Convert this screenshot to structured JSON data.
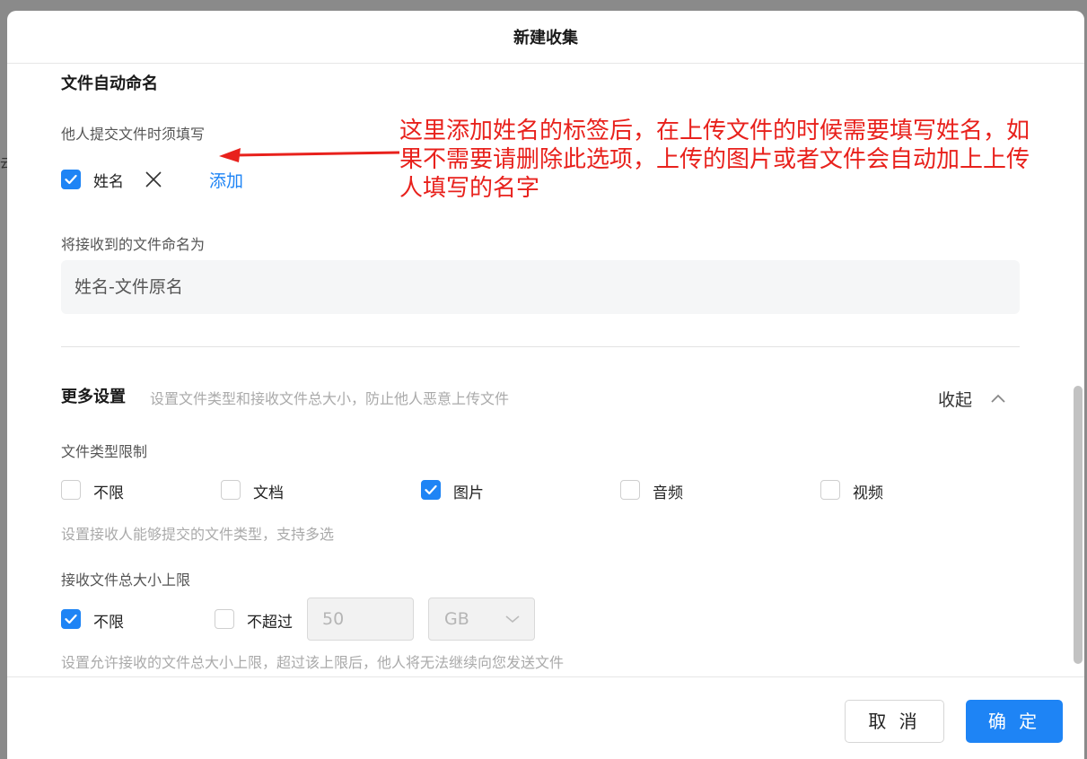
{
  "background_stub": "云",
  "dialog": {
    "title": "新建收集"
  },
  "naming": {
    "section_title": "文件自动命名",
    "required_label": "他人提交文件时须填写",
    "tag_label": "姓名",
    "tag_checked": true,
    "add_link": "添加",
    "rename_label": "将接收到的文件命名为",
    "rename_value": "姓名-文件原名"
  },
  "annotation": {
    "text": "这里添加姓名的标签后，在上传文件的时候需要填写姓名，如果不需要请删除此选项，上传的图片或者文件会自动加上上传人填写的名字",
    "color": "#e8211c"
  },
  "more_settings": {
    "title": "更多设置",
    "subtitle": "设置文件类型和接收文件总大小，防止他人恶意上传文件",
    "collapse_label": "收起"
  },
  "file_type": {
    "label": "文件类型限制",
    "options": [
      {
        "label": "不限",
        "checked": false
      },
      {
        "label": "文档",
        "checked": false
      },
      {
        "label": "图片",
        "checked": true
      },
      {
        "label": "音频",
        "checked": false
      },
      {
        "label": "视频",
        "checked": false
      }
    ],
    "hint": "设置接收人能够提交的文件类型，支持多选"
  },
  "size_limit": {
    "label": "接收文件总大小上限",
    "unlimited_label": "不限",
    "unlimited_checked": true,
    "not_exceed_label": "不超过",
    "not_exceed_checked": false,
    "value": "50",
    "unit": "GB",
    "hint": "设置允许接收的文件总大小上限，超过该上限后，他人将无法继续向您发送文件"
  },
  "footer": {
    "cancel_label": "取 消",
    "ok_label": "确 定"
  },
  "colors": {
    "primary": "#1e84f5",
    "annotation_red": "#e8211c"
  }
}
